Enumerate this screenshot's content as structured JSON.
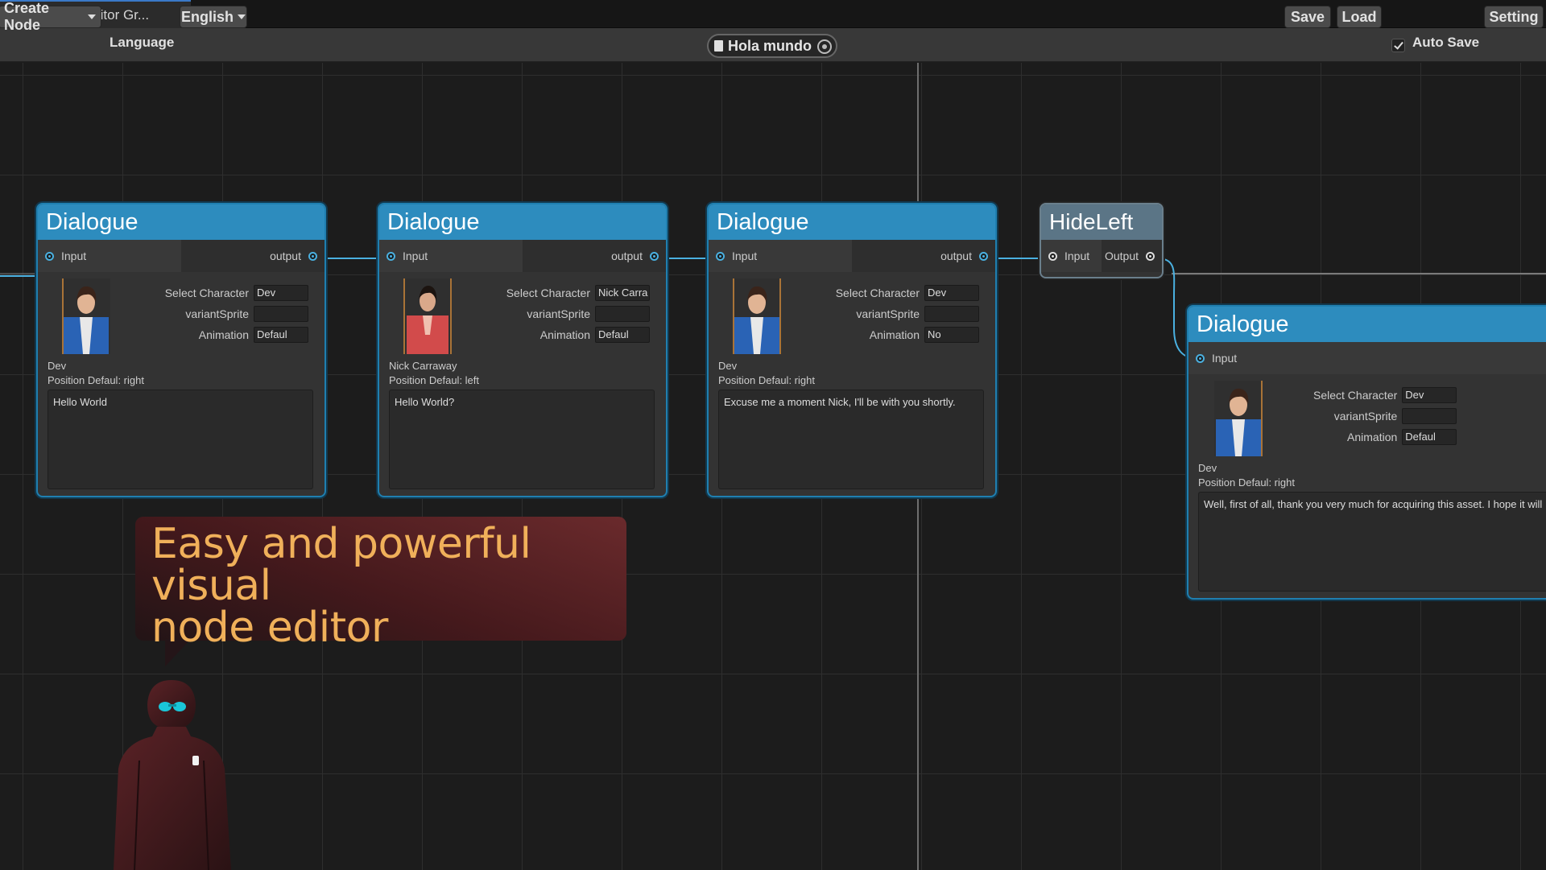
{
  "window": {
    "tab_title": "Dialogue Editor Gr..."
  },
  "toolbar": {
    "create_node": "Create Node",
    "language_label": "Language",
    "language_value": "English",
    "file_name": "Hola mundo",
    "save": "Save",
    "load": "Load",
    "auto_save": "Auto Save",
    "setting": "Setting"
  },
  "labels": {
    "input": "Input",
    "output_lower": "output",
    "output_upper": "Output",
    "select_character": "Select Character",
    "variant_sprite": "variantSprite",
    "animation": "Animation"
  },
  "nodes": [
    {
      "title": "Dialogue",
      "character": "Dev",
      "variant": "",
      "animation": "Defaul",
      "name": "Dev",
      "position": "Position Defaul: right",
      "text": "Hello World"
    },
    {
      "title": "Dialogue",
      "character": "Nick Carra",
      "variant": "",
      "animation": "Defaul",
      "name": "Nick Carraway",
      "position": "Position Defaul: left",
      "text": "Hello World?"
    },
    {
      "title": "Dialogue",
      "character": "Dev",
      "variant": "",
      "animation": "No",
      "name": "Dev",
      "position": "Position Defaul: right",
      "text": "Excuse me a moment Nick, I'll be with you shortly."
    },
    {
      "title": "Dialogue",
      "character": "Dev",
      "variant": "",
      "animation": "Defaul",
      "name": "Dev",
      "position": "Position Defaul: right",
      "text": "Well, first of all, thank you very much for acquiring this asset. I hope it will"
    }
  ],
  "hide_node": {
    "title": "HideLeft"
  },
  "promo": {
    "line1": "Easy and powerful visual",
    "line2": "node editor"
  },
  "colors": {
    "node_header": "#2d8cbe",
    "wire": "#4ab0e0",
    "promo_text": "#f0b05a",
    "background": "#1c1c1c"
  }
}
